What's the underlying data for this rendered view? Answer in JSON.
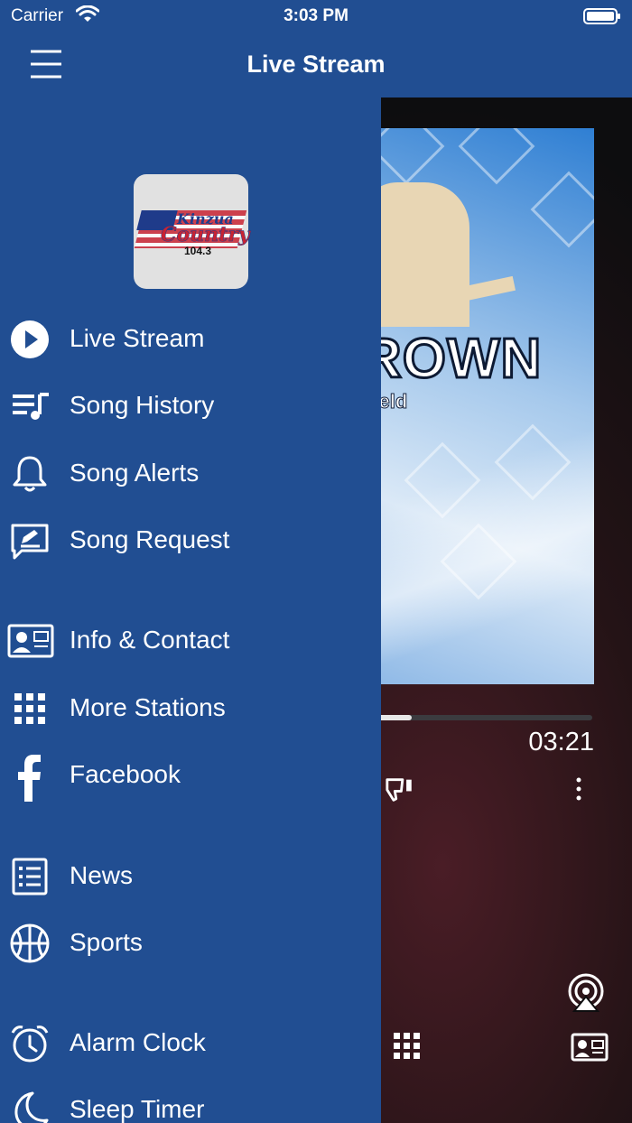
{
  "status_bar": {
    "carrier": "Carrier",
    "time": "3:03 PM"
  },
  "nav": {
    "title": "Live Stream",
    "menu_icon": "hamburger-menu-icon"
  },
  "drawer": {
    "logo": {
      "line1": "Kinzua",
      "line2": "Country",
      "line3": "104.3"
    },
    "items": [
      {
        "label": "Live Stream",
        "icon": "play-circle-icon"
      },
      {
        "label": "Song History",
        "icon": "playlist-icon"
      },
      {
        "label": "Song Alerts",
        "icon": "bell-icon"
      },
      {
        "label": "Song Request",
        "icon": "request-edit-icon"
      },
      {
        "label": "Info & Contact",
        "icon": "contact-card-icon"
      },
      {
        "label": "More Stations",
        "icon": "grid-icon"
      },
      {
        "label": "Facebook",
        "icon": "facebook-icon"
      },
      {
        "label": "News",
        "icon": "news-list-icon"
      },
      {
        "label": "Sports",
        "icon": "basketball-icon"
      },
      {
        "label": "Alarm Clock",
        "icon": "alarm-clock-icon"
      },
      {
        "label": "Sleep Timer",
        "icon": "moon-icon"
      }
    ]
  },
  "player": {
    "artwork_title_fragment": "ROWN",
    "artwork_subtitle_fragment": "hield",
    "duration": "03:21",
    "progress": 0.22
  },
  "colors": {
    "brand_blue": "#214e92",
    "white": "#ffffff"
  }
}
